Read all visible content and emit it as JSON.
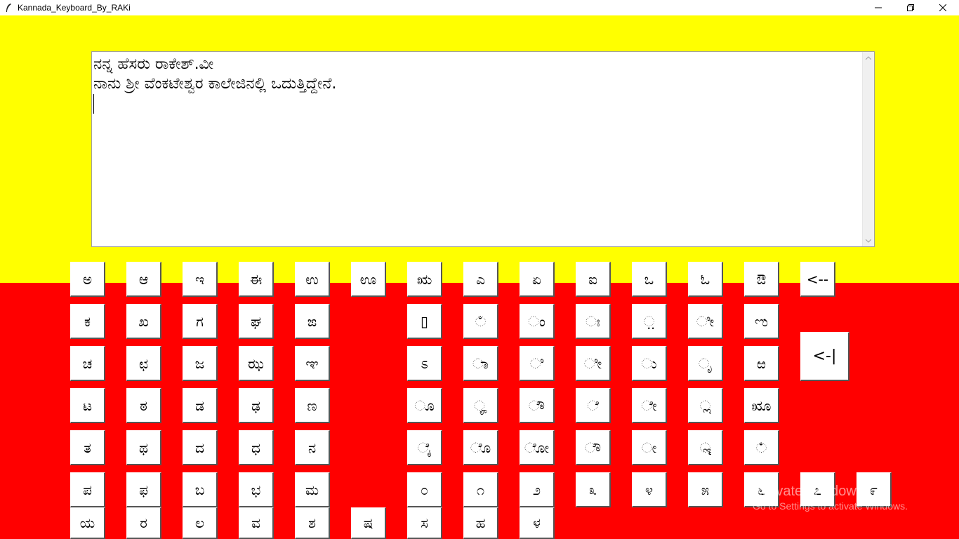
{
  "window": {
    "title": "Kannada_Keyboard_By_RAKi",
    "minimize_label": "—",
    "restore_label": "❐",
    "close_label": "✕"
  },
  "colors": {
    "top": "#ffff00",
    "bottom": "#ff0000"
  },
  "editor": {
    "lines": [
      "ನನ್ನ ಹೆಸರು ರಾಕೇಶ್.ವೀ",
      "ನಾನು ಶ್ರೀ ವೆಂಕಟೇಶ್ವರ ಕಾಲೇಜಿನಲ್ಲಿ ಒದುತ್ತಿದ್ದೇನೆ."
    ]
  },
  "keys": {
    "row1": [
      "ಅ",
      "ಆ",
      "ಇ",
      "ಈ",
      "ಉ",
      "ಊ",
      "ಋ",
      "ಎ",
      "ಏ",
      "ಐ",
      "ಒ",
      "ಓ",
      "ಔ",
      "<--"
    ],
    "row2": [
      "ಕ",
      "ಖ",
      "ಗ",
      "ಘ",
      "ಙ",
      "▯",
      "ಁ",
      "ಂ",
      "ಃ",
      "಼",
      "ೀ",
      "ಌ"
    ],
    "row3": [
      "ಚ",
      "ಛ",
      "ಜ",
      "ಝ",
      "ಞ",
      "ಽ",
      "ಾ",
      "ಿ",
      "ೀ",
      "ು",
      "ೃ",
      "ಱ",
      "<-|"
    ],
    "row4": [
      "ಟ",
      "ಠ",
      "ಡ",
      "ಢ",
      "ಣ",
      "ೂ",
      "ೄ",
      "ೌ",
      "ೆ",
      "ೇ",
      "ೢ",
      "ೠ"
    ],
    "row5": [
      "ತ",
      "ಥ",
      "ದ",
      "ಧ",
      "ನ",
      "ೈ",
      "ೊ",
      "ೋ",
      "ೌ",
      "ೕ",
      "ೣ",
      "ಁ"
    ],
    "row6": [
      "ಪ",
      "ಫ",
      "ಬ",
      "ಭ",
      "ಮ",
      "೦",
      "೧",
      "೨",
      "೩",
      "೪",
      "೫",
      "೬",
      "೭",
      "೯"
    ],
    "row7": [
      "ಯ",
      "ರ",
      "ಲ",
      "ವ",
      "ಶ",
      "ಷ",
      "ಸ",
      "ಹ",
      "ಳ"
    ]
  },
  "watermark": {
    "line1": "Activate Windows",
    "line2": "Go to Settings to activate Windows."
  }
}
